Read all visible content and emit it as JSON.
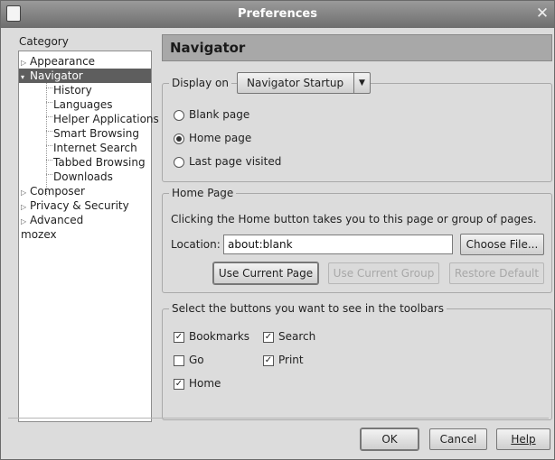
{
  "window": {
    "title": "Preferences",
    "close_glyph": "✕"
  },
  "category": {
    "label": "Category",
    "items": [
      {
        "label": "Appearance",
        "expander": "▷",
        "selected": false
      },
      {
        "label": "Navigator",
        "expander": "▾",
        "selected": true
      },
      {
        "label": "History"
      },
      {
        "label": "Languages"
      },
      {
        "label": "Helper Applications"
      },
      {
        "label": "Smart Browsing"
      },
      {
        "label": "Internet Search"
      },
      {
        "label": "Tabbed Browsing"
      },
      {
        "label": "Downloads"
      },
      {
        "label": "Composer",
        "expander": "▷"
      },
      {
        "label": "Privacy & Security",
        "expander": "▷"
      },
      {
        "label": "Advanced",
        "expander": "▷"
      },
      {
        "label": "mozex"
      }
    ]
  },
  "panel": {
    "title": "Navigator"
  },
  "display_on": {
    "label": "Display on",
    "selected": "Navigator Startup",
    "options": [
      {
        "label": "Blank page",
        "checked": false
      },
      {
        "label": "Home page",
        "checked": true
      },
      {
        "label": "Last page visited",
        "checked": false
      }
    ]
  },
  "home_page": {
    "legend": "Home Page",
    "description": "Clicking the Home button takes you to this page or group of pages.",
    "location_label": "Location:",
    "location_value": "about:blank",
    "choose_file": "Choose File...",
    "use_current_page": "Use Current Page",
    "use_current_group": "Use Current Group",
    "restore_default": "Restore Default"
  },
  "toolbars": {
    "legend": "Select the buttons you want to see in the toolbars",
    "items": [
      {
        "label": "Bookmarks",
        "checked": true
      },
      {
        "label": "Search",
        "checked": true
      },
      {
        "label": "Go",
        "checked": false
      },
      {
        "label": "Print",
        "checked": true
      },
      {
        "label": "Home",
        "checked": true
      }
    ]
  },
  "footer": {
    "ok": "OK",
    "cancel": "Cancel",
    "help": "Help"
  },
  "colors": {
    "selection": "#5e5e5e",
    "header": "#a8a8a8",
    "titlebar": "#7a7a7a"
  }
}
